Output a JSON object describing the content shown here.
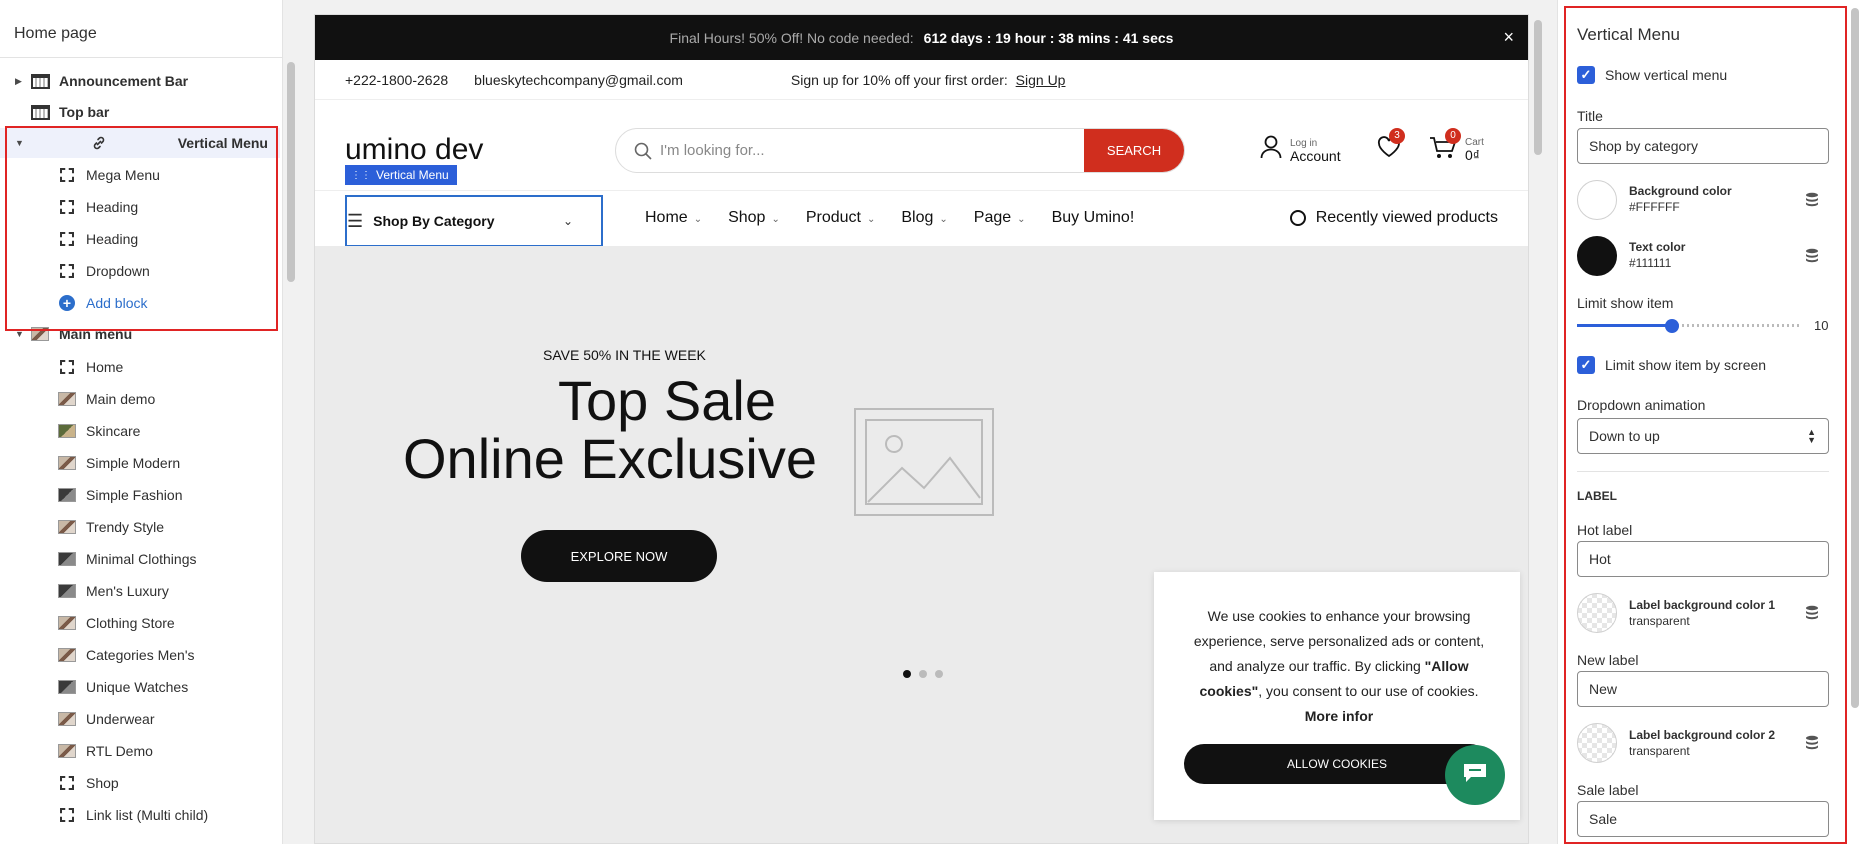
{
  "sidebar": {
    "title": "Home page",
    "items": [
      {
        "label": "Announcement Bar"
      },
      {
        "label": "Top bar"
      },
      {
        "label": "Vertical Menu"
      },
      {
        "label": "Mega Menu"
      },
      {
        "label": "Heading"
      },
      {
        "label": "Heading"
      },
      {
        "label": "Dropdown"
      },
      {
        "label": "Add block"
      },
      {
        "label": "Main menu"
      },
      {
        "label": "Home"
      },
      {
        "label": "Main demo"
      },
      {
        "label": "Skincare"
      },
      {
        "label": "Simple Modern"
      },
      {
        "label": "Simple Fashion"
      },
      {
        "label": "Trendy Style"
      },
      {
        "label": "Minimal Clothings"
      },
      {
        "label": "Men's Luxury"
      },
      {
        "label": "Clothing Store"
      },
      {
        "label": "Categories Men's"
      },
      {
        "label": "Unique Watches"
      },
      {
        "label": "Underwear"
      },
      {
        "label": "RTL Demo"
      },
      {
        "label": "Shop"
      },
      {
        "label": "Link list (Multi child)"
      }
    ]
  },
  "preview": {
    "announcement": {
      "text": "Final Hours! 50% Off! No code needed:",
      "countdown": "612 days : 19 hour : 38 mins : 41 secs",
      "close": "×"
    },
    "topbar": {
      "phone": "+222-1800-2628",
      "email": "blueskytechcompany@gmail.com",
      "signup_text": "Sign up for 10% off your first order:",
      "signup_link": "Sign Up"
    },
    "header": {
      "logo": "umino dev",
      "search_placeholder": "I'm looking for...",
      "search_button": "SEARCH",
      "account_small": "Log in",
      "account_big": "Account",
      "wishlist_count": "3",
      "cart_count": "0",
      "cart_small": "Cart",
      "cart_total": "0₫"
    },
    "nav": {
      "editor_tag": "Vertical Menu",
      "vertical_label": "Shop By Category",
      "items": [
        {
          "label": "Home",
          "dropdown": true
        },
        {
          "label": "Shop",
          "dropdown": true
        },
        {
          "label": "Product",
          "dropdown": true
        },
        {
          "label": "Blog",
          "dropdown": true
        },
        {
          "label": "Page",
          "dropdown": true
        },
        {
          "label": "Buy Umino!",
          "dropdown": false
        }
      ],
      "recently_viewed": "Recently viewed products"
    },
    "hero": {
      "eyebrow": "SAVE 50% IN THE WEEK",
      "title_line1": "Top Sale",
      "title_line2": "Online Exclusive",
      "button": "EXPLORE NOW"
    },
    "cookie": {
      "text_before": "We use cookies to enhance your browsing experience, serve personalized ads or content, and analyze our traffic. By clicking ",
      "bold_allow": "\"Allow cookies\"",
      "text_after": ", you consent to our use of cookies. ",
      "bold_more": "More infor",
      "button": "ALLOW COOKIES"
    }
  },
  "settings": {
    "title": "Vertical Menu",
    "show_vertical_menu": "Show vertical menu",
    "title_label": "Title",
    "title_value": "Shop by category",
    "bg_color_label": "Background color",
    "bg_color_value": "#FFFFFF",
    "text_color_label": "Text color",
    "text_color_value": "#111111",
    "limit_label": "Limit show item",
    "limit_value": "10",
    "limit_fraction": 0.42,
    "limit_by_screen": "Limit show item by screen",
    "dropdown_anim_label": "Dropdown animation",
    "dropdown_anim_value": "Down to up",
    "label_section": "LABEL",
    "hot_label": "Hot label",
    "hot_value": "Hot",
    "label_bg1": "Label background color 1",
    "label_bg1_value": "transparent",
    "new_label": "New label",
    "new_value": "New",
    "label_bg2": "Label background color 2",
    "label_bg2_value": "transparent",
    "sale_label": "Sale label",
    "sale_value": "Sale"
  },
  "colors": {
    "accent": "#2c5fd9",
    "highlight": "#e02424",
    "search_button": "#d02e1e",
    "chat": "#1d8a5e"
  }
}
